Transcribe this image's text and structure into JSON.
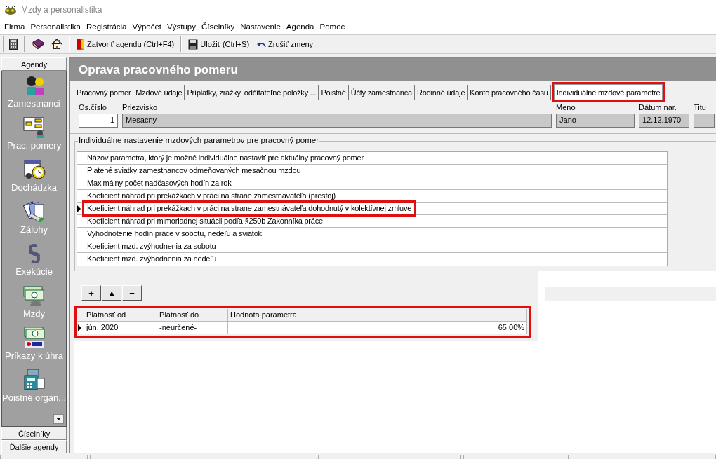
{
  "window": {
    "title": "Mzdy a personalistika"
  },
  "menu": [
    "Firma",
    "Personalistika",
    "Registrácia",
    "Výpočet",
    "Výstupy",
    "Číselníky",
    "Nastavenie",
    "Agenda",
    "Pomoc"
  ],
  "toolbar": [
    {
      "label": "Zatvoriť agendu (Ctrl+F4)"
    },
    {
      "label": "Uložiť (Ctrl+S)"
    },
    {
      "label": "Zrušiť zmeny"
    }
  ],
  "sidebar": {
    "header": "Agendy",
    "items": [
      {
        "label": "Zamestnanci"
      },
      {
        "label": "Prac. pomery"
      },
      {
        "label": "Dochádzka"
      },
      {
        "label": "Zálohy"
      },
      {
        "label": "Exekúcie"
      },
      {
        "label": "Mzdy"
      },
      {
        "label": "Príkazy k úhra"
      },
      {
        "label": "Poistné organ..."
      }
    ],
    "footer": [
      "Číselníky",
      "Ďalšie agendy"
    ]
  },
  "page_title": "Oprava pracovného pomeru",
  "tabs": [
    {
      "label": "Pracovný pomer",
      "selected": false,
      "highlighted": false
    },
    {
      "label": "Mzdové údaje",
      "selected": false,
      "highlighted": false
    },
    {
      "label": "Príplatky, zrážky, odčítateľné položky ...",
      "selected": false,
      "highlighted": false
    },
    {
      "label": "Poistné",
      "selected": false,
      "highlighted": false
    },
    {
      "label": "Účty zamestnanca",
      "selected": false,
      "highlighted": false
    },
    {
      "label": "Rodinné údaje",
      "selected": false,
      "highlighted": false
    },
    {
      "label": "Konto pracovného času",
      "selected": false,
      "highlighted": false
    },
    {
      "label": "Individuálne mzdové parametre",
      "selected": true,
      "highlighted": true
    }
  ],
  "fields": [
    {
      "label": "Os.číslo",
      "value": "1",
      "kind": "edit"
    },
    {
      "label": "Priezvisko",
      "value": "Mesacny",
      "kind": "readonly"
    },
    {
      "label": "Meno",
      "value": "Jano",
      "kind": "readonly"
    },
    {
      "label": "Dátum nar.",
      "value": "12.12.1970",
      "kind": "readonly"
    },
    {
      "label": "Titu",
      "kind": "readonly"
    }
  ],
  "group_title": "Individuálne nastavenie mzdových parametrov pre pracovný pomer",
  "params_table": {
    "header": "Názov parametra, ktorý je možné individuálne nastaviť pre aktuálny pracovný pomer",
    "rows": [
      {
        "name": "Platené sviatky zamestnancov odmeňovaných mesačnou mzdou",
        "selected": false,
        "highlighted": false
      },
      {
        "name": "Maximálny počet nadčasových hodín za rok",
        "selected": false,
        "highlighted": false
      },
      {
        "name": "Koeficient náhrad pri prekážkach v práci na strane zamestnávateľa (prestoj)",
        "selected": false,
        "highlighted": false
      },
      {
        "name": "Koeficient náhrad pri prekážkach v práci na strane zamestnávateľa dohodnutý v kolektívnej zmluve",
        "selected": true,
        "highlighted": true
      },
      {
        "name": "Koeficient náhrad pri mimoriadnej situácii podľa §250b Zakonníka práce",
        "selected": false,
        "highlighted": false
      },
      {
        "name": "Vyhodnotenie hodín práce v sobotu, nedeľu a sviatok",
        "selected": false,
        "highlighted": false
      },
      {
        "name": "Koeficient mzd. zvýhodnenia za sobotu",
        "selected": false,
        "highlighted": false
      },
      {
        "name": "Koeficient mzd. zvýhodnenia za nedeľu",
        "selected": false,
        "highlighted": false
      }
    ]
  },
  "value_buttons": [
    "+",
    "▲",
    "−"
  ],
  "values_table": {
    "highlighted": true,
    "columns": [
      "Platnosť od",
      "Platnosť do",
      "Hodnota parametra"
    ],
    "rows": [
      {
        "from": "jún, 2020",
        "to": "-neurčené-",
        "value": "65,00%",
        "selected": true
      }
    ]
  }
}
